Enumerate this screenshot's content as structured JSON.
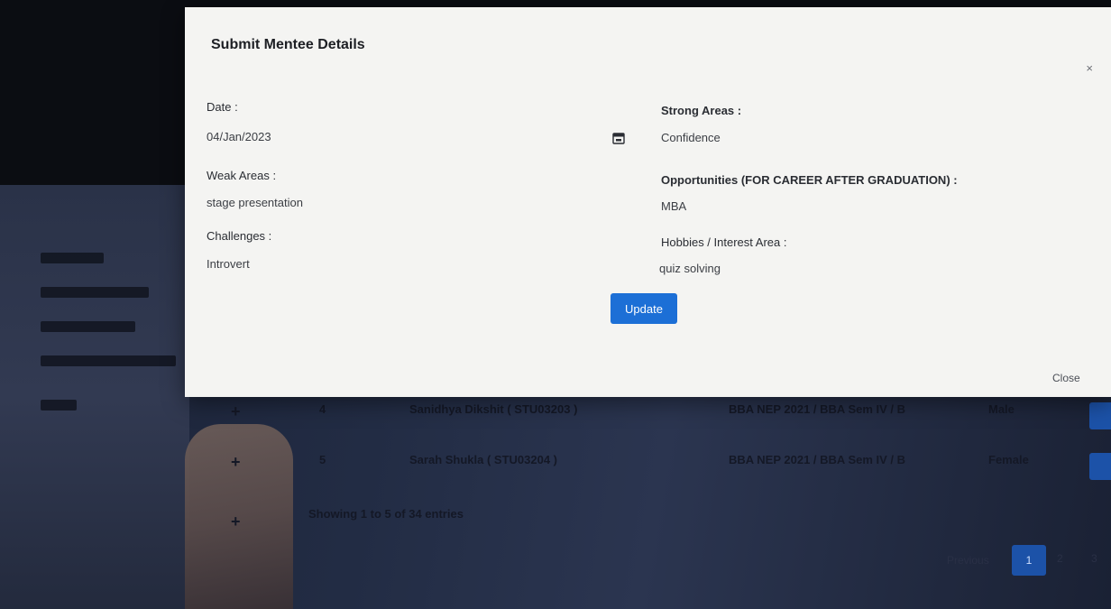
{
  "modal": {
    "title": "Submit Mentee Details",
    "close_x": "×",
    "date": {
      "label": "Date :",
      "value": "04/Jan/2023"
    },
    "weak_areas": {
      "label": "Weak Areas :",
      "value": "stage presentation"
    },
    "challenges": {
      "label": "Challenges :",
      "value": "Introvert"
    },
    "strong_areas": {
      "label": "Strong Areas :",
      "value": "Confidence"
    },
    "opportunities": {
      "label": "Opportunities (FOR CAREER AFTER GRADUATION) :",
      "value": "MBA"
    },
    "hobbies": {
      "label": "Hobbies / Interest Area :",
      "value": "quiz solving"
    },
    "update_label": "Update",
    "close_label": "Close"
  },
  "background": {
    "table_rows": [
      {
        "plus": "+",
        "num": "4",
        "name": "Sanidhya Dikshit ( STU03203 )",
        "class": "BBA NEP 2021 / BBA Sem IV / B",
        "gender": "Male"
      },
      {
        "plus": "+",
        "num": "5",
        "name": "Sarah Shukla ( STU03204 )",
        "class": "BBA NEP 2021 / BBA Sem IV / B",
        "gender": "Female"
      }
    ],
    "info": "Showing 1 to 5 of 34 entries",
    "extra_plus": "+",
    "pagination": {
      "prev": "Previous",
      "pages": [
        "1",
        "2",
        "3"
      ]
    }
  },
  "colors": {
    "accent": "#1c6fd6",
    "modal_bg": "#f4f4f2",
    "backdrop": "#0b0d12"
  },
  "icons": {
    "date_picker": "calendar-icon"
  }
}
